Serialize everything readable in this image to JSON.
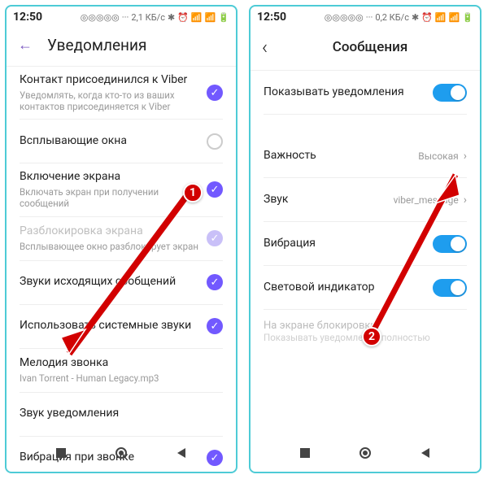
{
  "status": {
    "time": "12:50",
    "net_left": "2,1 КБ/с",
    "net_right": "0,2 КБ/с"
  },
  "left": {
    "back_icon": "←",
    "title": "Уведомления",
    "rows": [
      {
        "main": "Контакт присоединился к Viber",
        "sub": "Уведомлять, когда кто-то из ваших контактов присоединяется к Viber",
        "check": "on"
      },
      {
        "main": "Всплывающие окна",
        "sub": "",
        "check": "off"
      },
      {
        "main": "Включение экрана",
        "sub": "Включать экран при получении сообщений",
        "check": "on"
      },
      {
        "main": "Разблокировка экрана",
        "sub": "Всплывающее окно разблокирует экран",
        "check": "dim",
        "dimmed": true
      },
      {
        "main": "Звуки исходящих сообщений",
        "sub": "",
        "check": "on"
      },
      {
        "main": "Использовать системные звуки",
        "sub": "",
        "check": "on"
      },
      {
        "main": "Мелодия звонка",
        "sub": "Ivan Torrent - Human Legacy.mp3",
        "check": ""
      },
      {
        "main": "Звук уведомления",
        "sub": "",
        "check": ""
      },
      {
        "main": "Вибрация при звонке",
        "sub": "",
        "check": "on"
      }
    ]
  },
  "right": {
    "back_icon": "‹",
    "title": "Сообщения",
    "rows": [
      {
        "main": "Показывать уведомления",
        "ctl": "toggle"
      },
      {
        "_gap": true
      },
      {
        "main": "Важность",
        "value": "Высокая",
        "ctl": "value"
      },
      {
        "main": "Звук",
        "value": "viber_message",
        "ctl": "value"
      },
      {
        "main": "Вибрация",
        "ctl": "toggle"
      },
      {
        "main": "Световой индикатор",
        "ctl": "toggle"
      }
    ],
    "lock_note_1": "На экране блокировки",
    "lock_note_2": "Показывать уведомления полностью"
  },
  "markers": {
    "m1": "1",
    "m2": "2"
  }
}
